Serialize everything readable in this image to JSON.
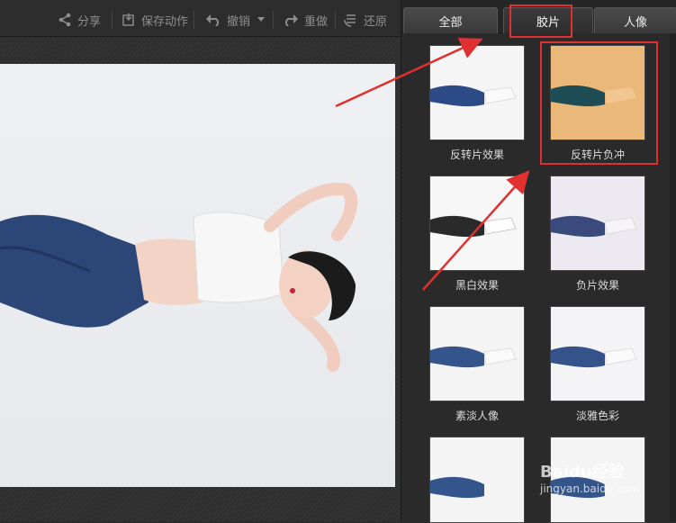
{
  "toolbar": {
    "share": "分享",
    "save_action": "保存动作",
    "undo": "撤销",
    "redo": "重做",
    "restore": "还原"
  },
  "tabs": [
    {
      "label": "全部"
    },
    {
      "label": "胶片"
    },
    {
      "label": "人像"
    }
  ],
  "effects": [
    {
      "label": "反转片效果"
    },
    {
      "label": "反转片负冲"
    },
    {
      "label": "黑白效果"
    },
    {
      "label": "负片效果"
    },
    {
      "label": "素淡人像"
    },
    {
      "label": "淡雅色彩"
    }
  ],
  "watermark": {
    "logo": "Baidu经验",
    "url": "jingyan.baidu.com"
  },
  "colors": {
    "highlight": "#e03030",
    "panel_bg": "#2a2a2a"
  }
}
